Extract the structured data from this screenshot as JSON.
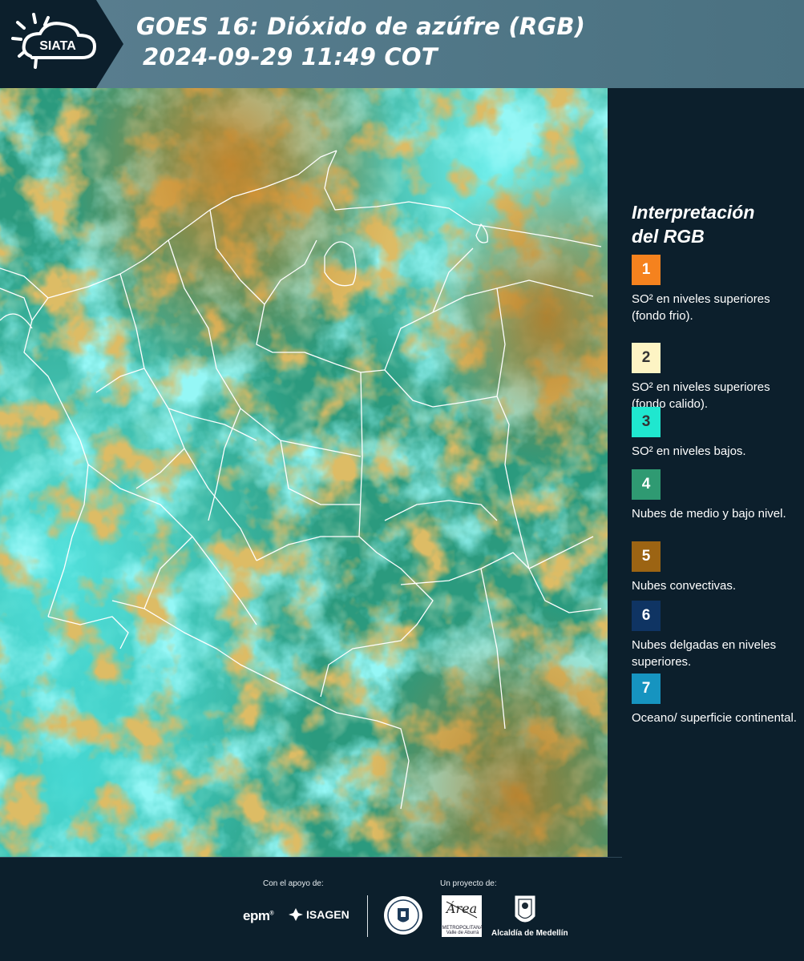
{
  "header": {
    "logo_text": "SIATA",
    "title_line1": "GOES 16: Dióxido de azúfre (RGB)",
    "title_line2": "2024-09-29 11:49 COT"
  },
  "legend": {
    "title_line1": "Interpretación",
    "title_line2": "del RGB",
    "items": [
      {
        "number": "1",
        "color": "#f5821e",
        "text_color": "#ffffff",
        "label": "SO² en niveles superiores (fondo frio)."
      },
      {
        "number": "2",
        "color": "#fdf4c4",
        "text_color": "#333333",
        "label": "SO² en niveles superiores (fondo calido)."
      },
      {
        "number": "3",
        "color": "#1fe7cf",
        "text_color": "#333333",
        "label": "SO² en niveles bajos."
      },
      {
        "number": "4",
        "color": "#2f9a72",
        "text_color": "#ffffff",
        "label": "Nubes de medio y bajo nivel."
      },
      {
        "number": "5",
        "color": "#9c6413",
        "text_color": "#ffffff",
        "label": "Nubes convectivas."
      },
      {
        "number": "6",
        "color": "#0f3463",
        "text_color": "#ffffff",
        "label": "Nubes delgadas en niveles superiores."
      },
      {
        "number": "7",
        "color": "#1694c0",
        "text_color": "#ffffff",
        "label": "Oceano/ superficie continental."
      }
    ]
  },
  "footer": {
    "support_label": "Con el apoyo de:",
    "project_label": "Un proyecto de:",
    "epm": "epm",
    "isagen": "ISAGEN",
    "area_name": "METROPOLITANA",
    "area_sub": "Valle de Aburrá",
    "area_script": "Área",
    "alcaldia": "Alcaldía de Medellín"
  }
}
